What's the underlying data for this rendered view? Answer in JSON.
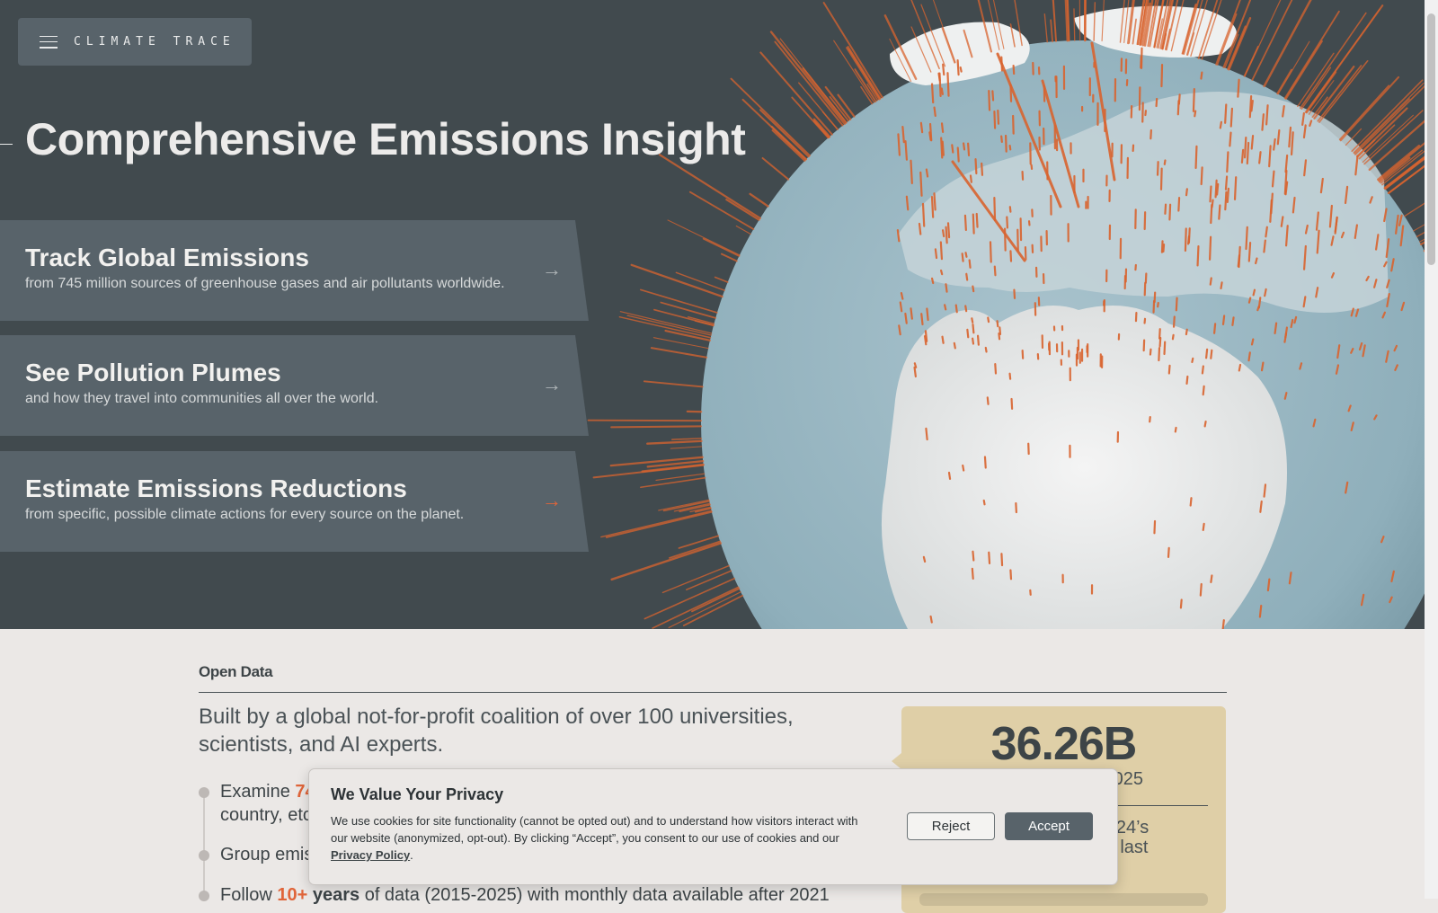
{
  "header": {
    "logo_text": "CLIMATE TRACE",
    "menu_icon": "hamburger-menu-icon"
  },
  "hero": {
    "title": "Comprehensive Emissions Insight",
    "cards": [
      {
        "title": "Track Global Emissions",
        "subtitle": "from 745 million sources of greenhouse gases and air pollutants worldwide.",
        "icon": "arrow-right-icon"
      },
      {
        "title": "See Pollution Plumes",
        "subtitle": "and how they travel into communities all over the world.",
        "icon": "arrow-right-icon"
      },
      {
        "title": "Estimate Emissions Reductions",
        "subtitle": "from specific, possible climate actions for every source on the planet.",
        "icon": "arrow-right-icon"
      }
    ]
  },
  "open_data": {
    "label": "Open Data",
    "lead": "Built by a global not-for-profit coalition of over 100 universities, scientists, and AI experts.",
    "bullets": [
      {
        "pre": "Examine ",
        "highlight": "74",
        "rest": "",
        "line2": "country, etc"
      },
      {
        "pre": "Group emis",
        "highlight": "",
        "rest": "",
        "line2": ""
      },
      {
        "pre": "Follow ",
        "highlight": "10+",
        "highlight2": "years",
        "rest": " of data (2015-2025) with monthly data available after 2021",
        "line2": ""
      }
    ]
  },
  "stat_card": {
    "value": "36.26B",
    "sub": "025",
    "note_line1": "n 2024’s",
    "note_line2": "time last"
  },
  "cookie": {
    "title": "We Value Your Privacy",
    "text": "We use cookies for site functionality (cannot be opted out) and to understand how visitors interact with our website (anonymized, opt-out). By clicking “Accept”, you consent to our use of cookies and our ",
    "link": "Privacy Policy",
    "end": ".",
    "reject_label": "Reject",
    "accept_label": "Accept"
  },
  "colors": {
    "hero_bg": "#414a4e",
    "card_bg": "#58636a",
    "accent": "#e0653a",
    "stat_bg": "#dfcfa7",
    "page_bg": "#ebe8e6"
  }
}
